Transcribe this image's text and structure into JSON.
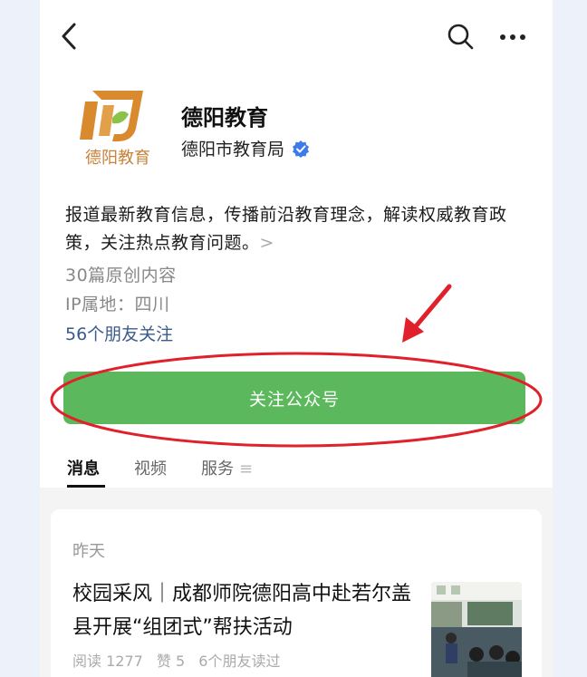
{
  "account": {
    "name": "德阳教育",
    "owner": "德阳市教育局",
    "logo_text": "德阳教育",
    "description": "报道最新教育信息，传播前沿教育理念，解读权威教育政策，关注热点教育问题。",
    "description_more": ">",
    "original_count": "30篇原创内容",
    "ip_location": "IP属地：四川",
    "friends_following": "56个朋友关注",
    "follow_label": "关注公众号"
  },
  "tabs": [
    {
      "label": "消息",
      "active": true
    },
    {
      "label": "视频",
      "active": false
    },
    {
      "label": "服务",
      "active": false
    }
  ],
  "tabs_menu_icon": "≡",
  "feed": {
    "date": "昨天",
    "article": {
      "title": "校园采风｜成都师院德阳高中赴若尔盖县开展“组团式”帮扶活动",
      "reads": "阅读 1277",
      "likes": "赞 5",
      "friends_read": "6个朋友读过"
    }
  },
  "icons": {
    "back": "back-chevron-icon",
    "search": "search-icon",
    "more": "more-dots-icon",
    "verified": "verified-badge-icon"
  },
  "colors": {
    "follow_button": "#5cb85c",
    "link_blue": "#3b5a8c",
    "verified_blue": "#3d7be8",
    "annotation_red": "#e0202a",
    "logo_orange": "#d98a2e",
    "logo_green": "#8bc34a"
  }
}
